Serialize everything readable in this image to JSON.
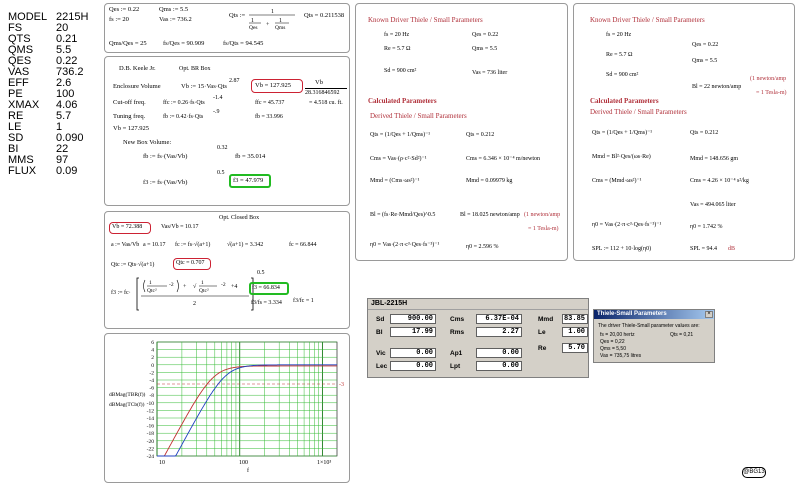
{
  "specs": [
    {
      "k": "MODEL",
      "v": "2215H"
    },
    {
      "k": "FS",
      "v": "20"
    },
    {
      "k": "QTS",
      "v": "0.21"
    },
    {
      "k": "QMS",
      "v": "5.5"
    },
    {
      "k": "QES",
      "v": "0.22"
    },
    {
      "k": "VAS",
      "v": "736.2"
    },
    {
      "k": "EFF",
      "v": "2.6"
    },
    {
      "k": "PE",
      "v": "100"
    },
    {
      "k": "XMAX",
      "v": "4.06"
    },
    {
      "k": "RE",
      "v": "5.7"
    },
    {
      "k": "LE",
      "v": "1"
    },
    {
      "k": "SD",
      "v": "0.090"
    },
    {
      "k": "BI",
      "v": "22"
    },
    {
      "k": "MMS",
      "v": "97"
    },
    {
      "k": "FLUX",
      "v": "0.09"
    }
  ],
  "p1": {
    "qes": "Qes := 0.22",
    "qms": "Qms := 5.5",
    "qts_lhs": "Qts :=",
    "qts_val": "Qts = 0.211538",
    "fs": "fs := 20",
    "vas": "Vas := 736.2",
    "r1": "Qms/Qes = 25",
    "r2": "fs/Qes = 90.909",
    "r3": "fs/Qts = 94.545"
  },
  "p2": {
    "author": "D.B. Keele Jr.",
    "title": "Opt. BR Box",
    "enc_label": "Enclosure Volume",
    "enc_eq": "Vb := 15·Vas·Qts",
    "enc_exp": "2.87",
    "vb_val": "Vb = 127.925",
    "vb_frac_top": "Vb",
    "vb_frac_bot": "28.316846592",
    "vb_cuft": "= 4.518 cu. ft.",
    "cut_label": "Cut-off freq.",
    "cut_eq": "ffc := 0.26·fs·Qts",
    "cut_exp": "-1.4",
    "cut_val": "ffc = 45.737",
    "tun_label": "Tuning freq.",
    "tun_eq": "fb := 0.42·fs·Qts",
    "tun_exp": "-.9",
    "tun_val": "fb = 33.996",
    "vb_echo": "Vb = 127.925",
    "newbox": "New Box Volume:",
    "fb_eq": "fb := fs·(Vas/Vb)",
    "fb_exp": "0.32",
    "fb_val": "fb = 35.014",
    "f3_eq": "f3 := fs·(Vas/Vb)",
    "f3_exp": "0.5",
    "f3_val": "f3 = 47.979"
  },
  "p3": {
    "title": "Opt. Closed Box",
    "vb_box": "Vb = 72.388",
    "vb_eq": "Vas/Vb = 10.17",
    "a_eq": "a := Vas/Vb",
    "a_val": "a = 10.17",
    "fc_eq": "fc := fs·√(a+1)",
    "sqrt_val": "√(a+1) = 3.342",
    "fc_val": "fc = 66.844",
    "qtc_eq": "Qtc := Qts·√(a+1)",
    "qtc_val": "Qtc = 0.707",
    "f3_eq": "f3 := fc·[ ... ]",
    "f3_exp": "0.5",
    "f3_val": "f3 = 66.834",
    "ratio1": "f3/fs = 3.334",
    "ratio2": "f3/fc = 1"
  },
  "graph": {
    "ylabel1": "dBMag(TBR(f))",
    "ylabel2": "dBMag(TCb(f))",
    "yticks": [
      "6",
      "4",
      "2",
      "0",
      "-2",
      "-4",
      "-6",
      "-8",
      "-10",
      "-12",
      "-14",
      "-16",
      "-18",
      "-20",
      "-22",
      "-24"
    ],
    "xticks": [
      "10",
      "100",
      "1×10³"
    ],
    "xlabel": "f",
    "ref_label": "-3"
  },
  "p4": {
    "title": "Known Driver Thiele / Small Parameters",
    "fs": "fs = 20 Hz",
    "qes": "Qes = 0.22",
    "re": "Re = 5.7 Ω",
    "qms": "Qms = 5.5",
    "sd": "Sd = 900 cm²",
    "vas": "Vas = 736 liter",
    "calc": "Calculated Parameters",
    "derived": "Derived Thiele / Small Parameters",
    "qts_eq": "Qts = (1/Qes + 1/Qms)⁻¹",
    "qts_val": "Qts = 0.212",
    "cms_eq": "Cms = Vas·(ρ·c²·Sd²)⁻¹",
    "cms_val": "Cms = 6.346 × 10⁻⁴ m/newton",
    "mmd_eq": "Mmd = (Cms·ωs²)⁻¹",
    "mmd_val": "Mmd = 0.09979 kg",
    "bl_eq": "Bl = (fs·Re·Mmd/Qes)^0.5",
    "bl_val": "Bl = 18.025 newton/amp",
    "bl_note1": "(1 newton/amp",
    "bl_note2": "= 1 Tesla-m)",
    "eta_eq": "η0 = Vas·(2·π·c³·Qes·fs⁻³)⁻¹",
    "eta_val": "η0 = 2.596 %"
  },
  "p5": {
    "title": "Known Driver Thiele / Small Parameters",
    "fs": "fs = 20 Hz",
    "qes": "Qes = 0.22",
    "re": "Re = 5.7 Ω",
    "qms": "Qms = 5.5",
    "sd": "Sd = 900 cm²",
    "bl": "Bl = 22 newton/amp",
    "bl_note1": "(1 newton/amp",
    "bl_note2": "= 1 Tesla-m)",
    "calc": "Calculated Parameters",
    "derived": "Derived Thiele / Small Parameters",
    "qts_eq": "Qts = (1/Qes + 1/Qms)⁻¹",
    "qts_val": "Qts = 0.212",
    "mmd_eq": "Mmd = Bl²·Qes/(ωs·Re)",
    "mmd_val": "Mmd = 148.656 gm",
    "cms_eq": "Cms = (Mmd·ωs²)⁻¹",
    "cms_val": "Cms = 4.26 × 10⁻⁴ s²/kg",
    "vas_val": "Vas = 494.065 liter",
    "eta_eq": "η0 = Vas·(2·π·c³·Qes·fs⁻³)⁻¹",
    "eta_val": "η0 = 1.742 %",
    "spl_eq": "SPL := 112 + 10·log(η0)",
    "spl_val": "SPL = 94.4",
    "spl_unit": "dB"
  },
  "jbl": {
    "title": "JBL-2215H",
    "sd_l": "Sd",
    "sd_v": "900.00",
    "cms_l": "Cms",
    "cms_v": "6.37E-04",
    "mmd_l": "Mmd",
    "mmd_v": "83.85",
    "bl_l": "Bl",
    "bl_v": "17.99",
    "rms_l": "Rms",
    "rms_v": "2.27",
    "le_l": "Le",
    "le_v": "1.00",
    "re_l": "Re",
    "re_v": "5.70",
    "vic_l": "Vic",
    "vic_v": "0.00",
    "ap1_l": "Ap1",
    "ap1_v": "0.00",
    "lec_l": "Lec",
    "lec_v": "0.00",
    "lpt_l": "Lpt",
    "lpt_v": "0.00"
  },
  "ts": {
    "title": "Thiele-Small Parameters",
    "close": "×",
    "intro": "The driver Thiele-Small parameter values are:",
    "l1": "fs = 20,00 hertz",
    "l1b": "Qts = 0,21",
    "l2": "Qes = 0,22",
    "l3": "Qms = 5,50",
    "l4": "Vas = 735,75 litres"
  },
  "badge": "@BG13"
}
